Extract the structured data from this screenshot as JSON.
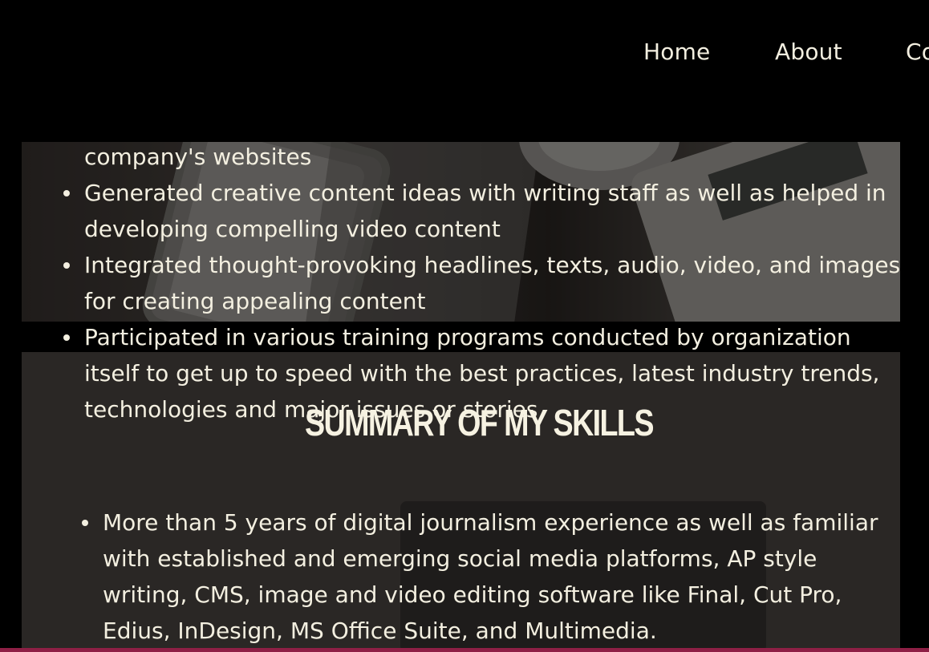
{
  "nav": {
    "items": [
      {
        "label": "Home"
      },
      {
        "label": "About"
      },
      {
        "label": "Co"
      }
    ]
  },
  "experience": {
    "continued_line": "company's websites",
    "bullets": [
      "Generated creative content ideas with writing staff as well as helped in developing compelling video content",
      "Integrated thought-provoking headlines, texts, audio, video, and images for creating appealing content",
      "Participated in various training programs conducted by organization itself to get up to speed with the best practices, latest industry trends, technologies and major issues or stories"
    ]
  },
  "skills": {
    "heading": "Summary of my skills",
    "bullets": [
      "More than 5 years of digital journalism experience as well as familiar with established and emerging social media platforms, AP style writing, CMS, image and video editing software like Final, Cut Pro, Edius, InDesign, MS Office Suite, and Multimedia."
    ]
  },
  "colors": {
    "text": "#f3efe0",
    "background": "#000000",
    "section_bg": "#2a2725",
    "accent_line": "#8e1f45"
  }
}
